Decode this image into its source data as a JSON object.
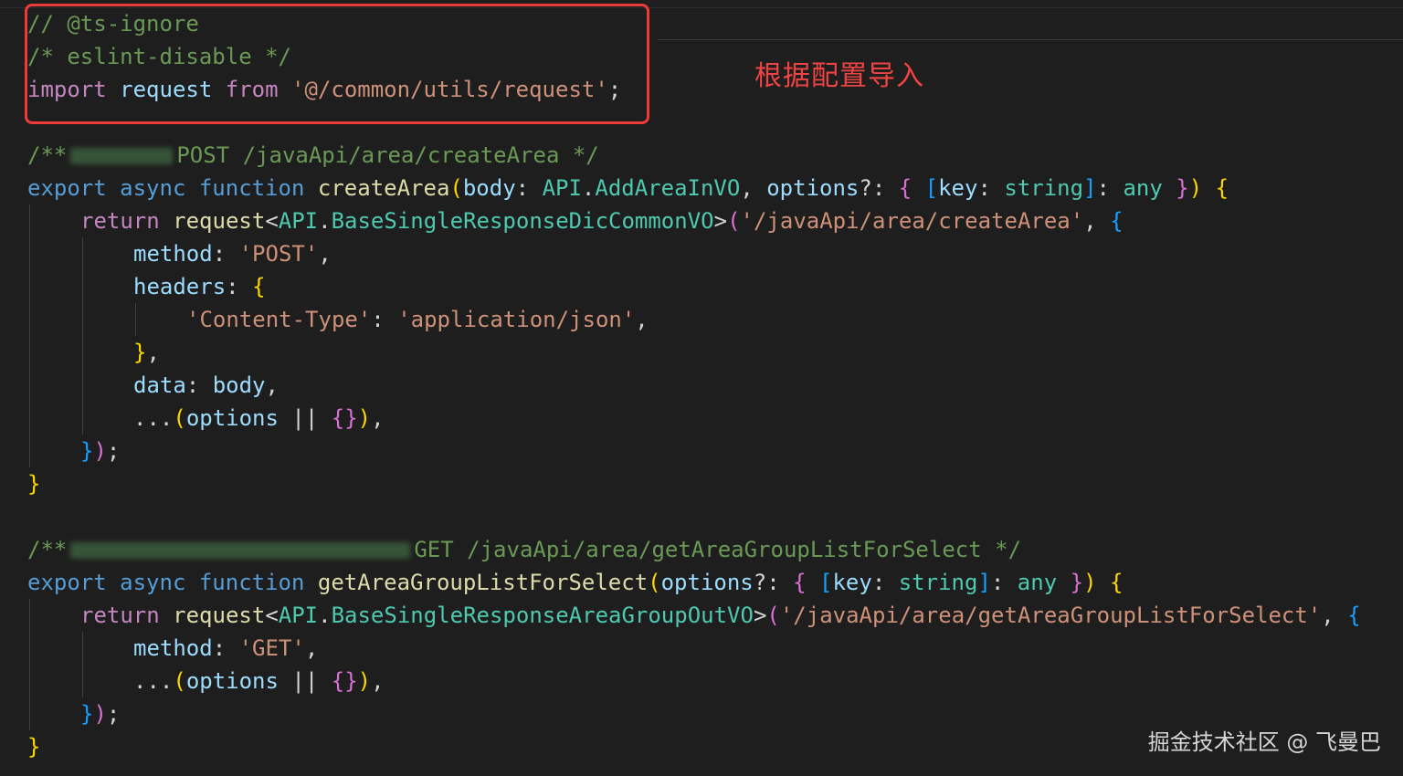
{
  "code": {
    "header": {
      "line1": "// @ts-ignore",
      "line2": "/* eslint-disable */",
      "line3": {
        "import": "import",
        "name": "request",
        "from": "from",
        "path": "'@/common/utils/request'",
        "semi": ";"
      }
    },
    "fn1": {
      "comment_start": "/**",
      "comment_end": "POST /javaApi/area/createArea */",
      "export": "export",
      "async": "async",
      "function": "function",
      "name": "createArea",
      "p_open": "(",
      "param1": "body",
      "colon1": ": ",
      "type1_ns": "API",
      "dot1": ".",
      "type1": "AddAreaInVO",
      "comma1": ", ",
      "param2": "options",
      "opt": "?: ",
      "brace_open": "{",
      "sp1": " ",
      "sq_open": "[",
      "key": "key",
      "colon2": ": ",
      "string": "string",
      "sq_close": "]",
      "colon3": ": ",
      "any": "any",
      "sp2": " ",
      "brace_close": "}",
      "p_close": ")",
      "sp3": " ",
      "body_open": "{",
      "return": "return",
      "request": "request",
      "lt": "<",
      "resp_ns": "API",
      "dot2": ".",
      "resp_type": "BaseSingleResponseDicCommonVO",
      "gt": ">",
      "call_open": "(",
      "url": "'/javaApi/area/createArea'",
      "comma2": ", ",
      "obj_open": "{",
      "method_key": "method",
      "colon_m": ": ",
      "method_val": "'POST'",
      "comma_m": ",",
      "headers_key": "headers",
      "colon_h": ": ",
      "headers_open": "{",
      "ct_key": "'Content-Type'",
      "colon_ct": ": ",
      "ct_val": "'application/json'",
      "comma_ct": ",",
      "headers_close": "}",
      "comma_hc": ",",
      "data_key": "data",
      "colon_d": ": ",
      "data_val": "body",
      "comma_d": ",",
      "spread": "...",
      "sp_open": "(",
      "spread_var": "options",
      "or": " || ",
      "empty_obj": "{}",
      "sp_close": ")",
      "comma_s": ",",
      "obj_close": "}",
      "call_close": ")",
      "semi": ";",
      "body_close": "}"
    },
    "fn2": {
      "comment_start": "/**",
      "comment_end": "GET /javaApi/area/getAreaGroupListForSelect */",
      "export": "export",
      "async": "async",
      "function": "function",
      "name": "getAreaGroupListForSelect",
      "p_open": "(",
      "param": "options",
      "opt": "?: ",
      "brace_open": "{",
      "sp1": " ",
      "sq_open": "[",
      "key": "key",
      "colon": ": ",
      "string": "string",
      "sq_close": "]",
      "colon2": ": ",
      "any": "any",
      "sp2": " ",
      "brace_close": "}",
      "p_close": ")",
      "sp3": " ",
      "body_open": "{",
      "return": "return",
      "request": "request",
      "lt": "<",
      "resp_ns": "API",
      "dot": ".",
      "resp_type": "BaseSingleResponseAreaGroupOutVO",
      "gt": ">",
      "call_open": "(",
      "url": "'/javaApi/area/getAreaGroupListForSelect'",
      "comma": ", ",
      "obj_open": "{",
      "method_key": "method",
      "colon_m": ": ",
      "method_val": "'GET'",
      "comma_m": ",",
      "spread": "...",
      "sp_open": "(",
      "spread_var": "options",
      "or": " || ",
      "empty_obj": "{}",
      "sp_close": ")",
      "comma_s": ",",
      "obj_close": "}",
      "call_close": ")",
      "semi": ";",
      "body_close": "}"
    }
  },
  "annotation": "根据配置导入",
  "watermark": "掘金技术社区 @ 飞曼巴",
  "colors": {
    "background": "#1e1e1e",
    "comment": "#6a9955",
    "keyword_control": "#c586c0",
    "keyword_storage": "#569cd6",
    "variable": "#9cdcfe",
    "function": "#dcdcaa",
    "string": "#ce9178",
    "type": "#4ec9b0",
    "bracket_level1": "#ffd700",
    "bracket_level2": "#da70d6",
    "bracket_level3": "#179fff",
    "highlight_box": "#ed3b3b",
    "annotation": "#ef4444"
  }
}
